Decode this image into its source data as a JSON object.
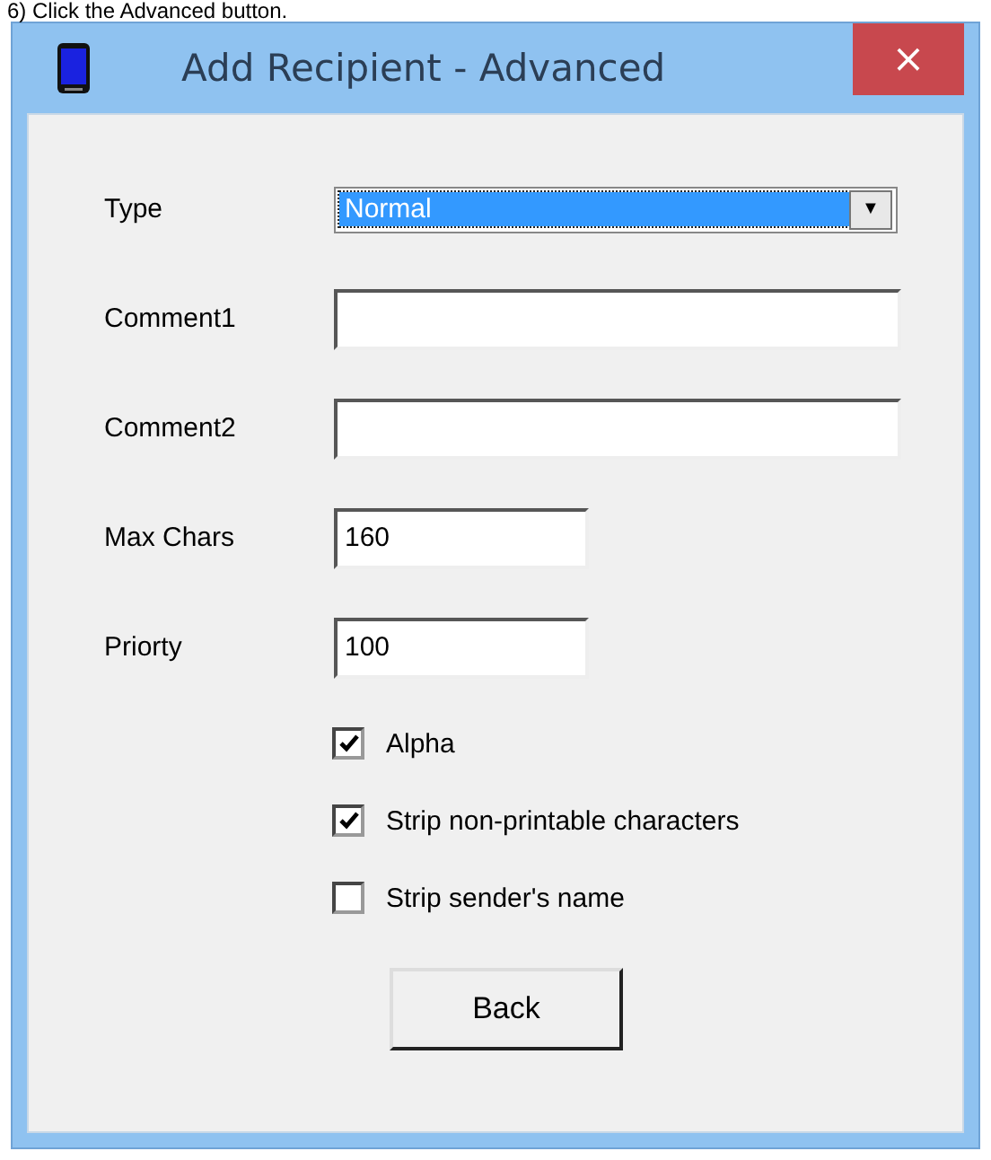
{
  "caption": "6) Click the Advanced button.",
  "window": {
    "title": "Add Recipient - Advanced",
    "close": "×"
  },
  "type_field": {
    "label": "Type",
    "value": "Normal",
    "selected": true,
    "arrow": "▼"
  },
  "fields": [
    {
      "label": "Comment1",
      "kind": "wide"
    },
    {
      "label": "Comment2",
      "kind": "wide"
    },
    {
      "label": "Max Chars",
      "value": "160",
      "kind": "short"
    },
    {
      "label": "Priorty",
      "value": "100",
      "kind": "short"
    }
  ],
  "checkboxes": [
    {
      "label": "Alpha",
      "checked": true
    },
    {
      "label": "Strip non-printable characters",
      "checked": true
    },
    {
      "label": "Strip sender's name",
      "checked": false
    }
  ],
  "buttons": [
    {
      "label": "Back"
    }
  ]
}
